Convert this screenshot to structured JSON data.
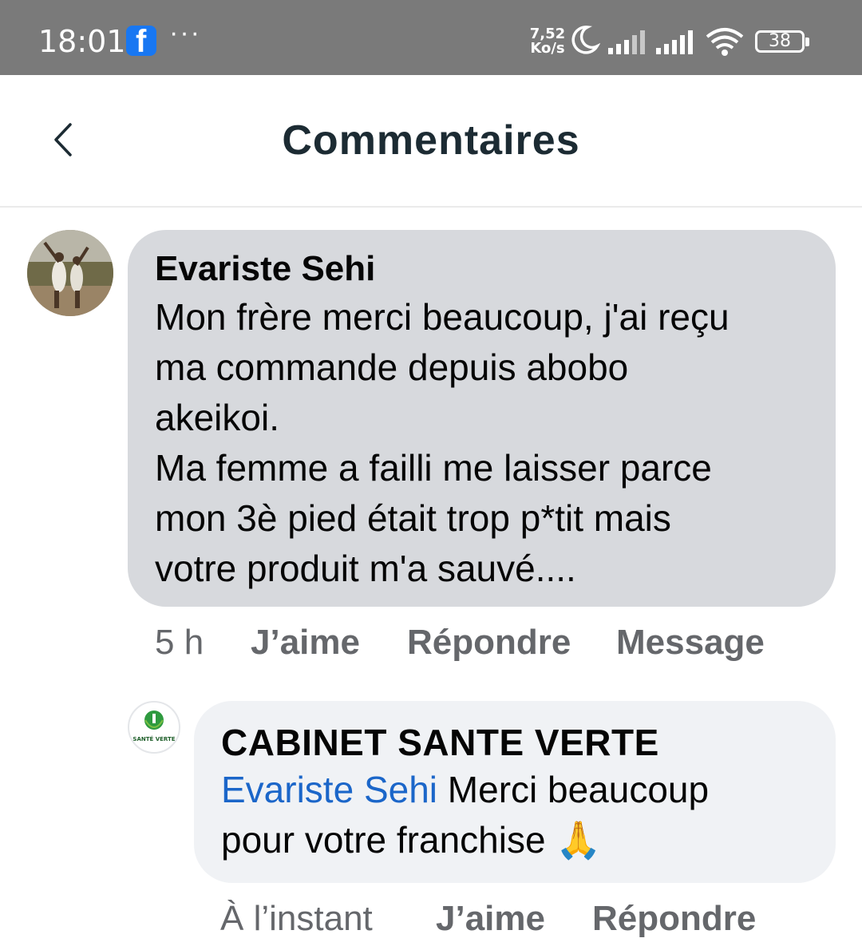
{
  "status_bar": {
    "time": "18:01",
    "app_icon": "facebook-icon",
    "more": "···",
    "speed_value": "7,52",
    "speed_unit": "Ko/s",
    "battery": "38",
    "icons": [
      "moon-icon",
      "signal-icon",
      "signal-icon",
      "wifi-icon",
      "battery-icon"
    ]
  },
  "header": {
    "back_icon": "chevron-left-icon",
    "title": "Commentaires"
  },
  "comments": [
    {
      "author": "Evariste Sehi",
      "lines": [
        "Mon frère merci beaucoup, j'ai reçu",
        "ma commande depuis abobo",
        "akeikoi.",
        "Ma femme a failli me laisser parce",
        "mon 3è pied était trop p*tit mais",
        "votre produit m'a sauvé...."
      ],
      "time": "5 h",
      "like_label": "J’aime",
      "reply_label": "Répondre",
      "message_label": "Message"
    },
    {
      "author": "CABINET SANTE VERTE",
      "avatar_text": "SANTÉ VERTE",
      "mention": "Evariste Sehi",
      "text_after_mention": " Merci beaucoup",
      "line2": "pour votre franchise ",
      "emoji": "🙏",
      "time": "À l’instant",
      "like_label": "J’aime",
      "reply_label": "Répondre"
    }
  ],
  "colors": {
    "status_bar_bg": "#7a7a7a",
    "bubble_gray": "#d7d9dd",
    "bubble_light": "#f0f2f5",
    "mention_blue": "#1b66c9",
    "secondary_text": "#65676b",
    "title_text": "#1c2b33"
  }
}
